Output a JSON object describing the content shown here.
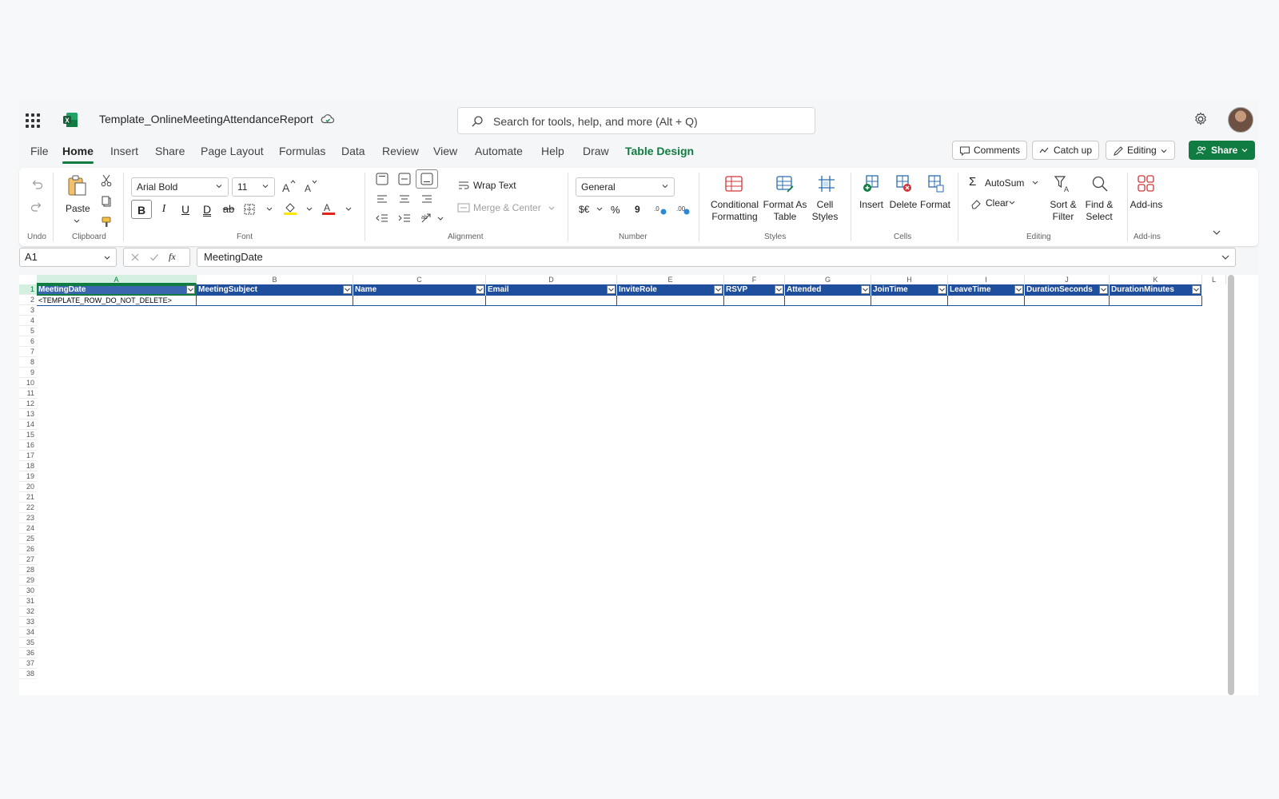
{
  "app": {
    "doc_title": "Template_OnlineMeetingAttendanceReport",
    "search_placeholder": "Search for tools, help, and more (Alt + Q)",
    "brand_color": "#107c41",
    "table_header_color": "#1f4e9c"
  },
  "menu": {
    "tabs": [
      "File",
      "Home",
      "Insert",
      "Share",
      "Page Layout",
      "Formulas",
      "Data",
      "Review",
      "View",
      "Automate",
      "Help",
      "Draw",
      "Table Design"
    ],
    "active_tab": "Home",
    "contextual_tab": "Table Design",
    "comments_label": "Comments",
    "catchup_label": "Catch up",
    "editing_label": "Editing",
    "share_label": "Share"
  },
  "ribbon": {
    "undo_group": "Undo",
    "clipboard": {
      "paste": "Paste",
      "label": "Clipboard"
    },
    "font": {
      "name": "Arial Bold",
      "size": "11",
      "label": "Font",
      "bold": "B",
      "italic": "I",
      "underline": "U",
      "double_underline": "D",
      "strike": "ab"
    },
    "alignment": {
      "wrap": "Wrap Text",
      "merge": "Merge & Center",
      "label": "Alignment"
    },
    "number": {
      "format": "General",
      "currency": "$€",
      "percent": "%",
      "comma": "9",
      "label": "Number"
    },
    "styles": {
      "conditional_1": "Conditional",
      "conditional_2": "Formatting",
      "format_table_1": "Format As",
      "format_table_2": "Table",
      "cell_styles_1": "Cell",
      "cell_styles_2": "Styles",
      "label": "Styles"
    },
    "cells": {
      "insert": "Insert",
      "delete": "Delete",
      "format": "Format",
      "label": "Cells"
    },
    "editing": {
      "autosum": "AutoSum",
      "clear": "Clear",
      "sort_1": "Sort &",
      "sort_2": "Filter",
      "find_1": "Find &",
      "find_2": "Select",
      "label": "Editing"
    },
    "addins": {
      "button": "Add-ins",
      "label": "Add-ins"
    }
  },
  "formula_bar": {
    "name_box": "A1",
    "fx": "fx",
    "content": "MeetingDate"
  },
  "sheet": {
    "columns": [
      "A",
      "B",
      "C",
      "D",
      "E",
      "F",
      "G",
      "H",
      "I",
      "J",
      "K",
      "L"
    ],
    "headers": [
      "MeetingDate",
      "MeetingSubject",
      "Name",
      "Email",
      "InviteRole",
      "RSVP",
      "Attended",
      "JoinTime",
      "LeaveTime",
      "DurationSeconds",
      "DurationMinutes"
    ],
    "row2_a": "<TEMPLATE_ROW_DO_NOT_DELETE>",
    "row_count": 38
  }
}
